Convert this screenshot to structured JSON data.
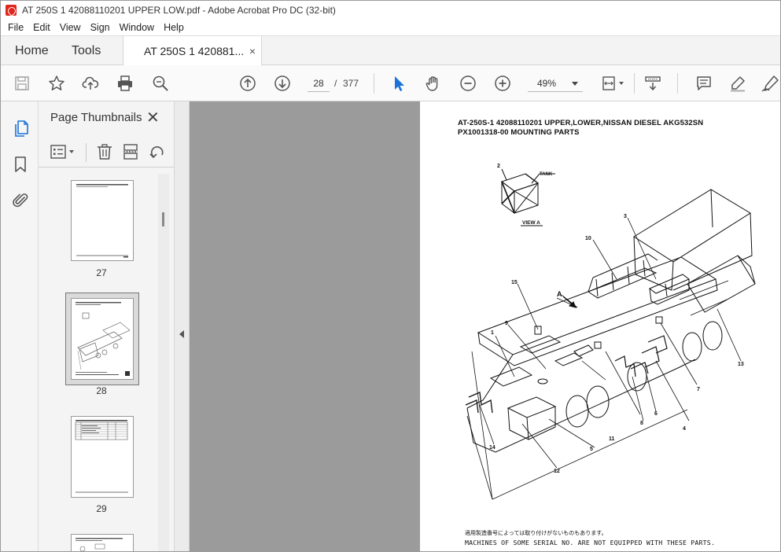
{
  "window": {
    "title": "AT 250S 1 42088110201 UPPER LOW.pdf - Adobe Acrobat Pro DC (32-bit)"
  },
  "menu": [
    "File",
    "Edit",
    "View",
    "Sign",
    "Window",
    "Help"
  ],
  "tabs": {
    "home": "Home",
    "tools": "Tools",
    "document": "AT 250S 1 420881...",
    "close_glyph": "×"
  },
  "toolbar": {
    "current_page": "28",
    "page_separator": "/",
    "total_pages": "377",
    "zoom": "49%"
  },
  "thumbnails_panel": {
    "title": "Page Thumbnails",
    "close_glyph": "✕",
    "pages": [
      {
        "number": "27"
      },
      {
        "number": "28",
        "selected": true
      },
      {
        "number": "29"
      }
    ]
  },
  "document_page": {
    "heading_line1": "AT-250S-1 42088110201 UPPER,LOWER,NISSAN DIESEL AKG532SN",
    "heading_line2": "PX1001318-00 MOUNTING PARTS",
    "view_label_tank": "TANK",
    "view_label": "VIEW A",
    "arrow_label": "A",
    "callouts": [
      "1",
      "2",
      "3",
      "4",
      "5",
      "6",
      "7",
      "8",
      "9",
      "10",
      "11",
      "12",
      "13",
      "14",
      "15"
    ],
    "footnote_jp": "適用製造番号によっては取り付けがないものもあります。",
    "footnote_en": "MACHINES OF SOME SERIAL NO. ARE NOT EQUIPPED WITH THESE PARTS."
  },
  "colors": {
    "acrobat_red": "#e0271d",
    "select_blue": "#1a73d9",
    "doc_background": "#9b9b9b"
  }
}
